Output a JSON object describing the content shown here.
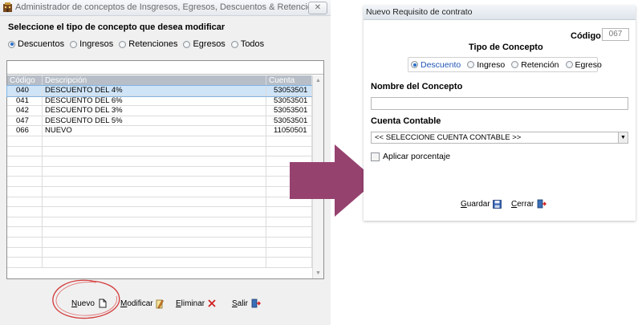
{
  "left_window": {
    "title": "Administrador de conceptos de Insgresos, Egresos, Descuentos & Retenciones",
    "close_label": "✕",
    "heading": "Seleccione el tipo de concepto que desea modificar",
    "filter_options": [
      {
        "label": "Descuentos",
        "checked": true
      },
      {
        "label": "Ingresos",
        "checked": false
      },
      {
        "label": "Retenciones",
        "checked": false
      },
      {
        "label": "Egresos",
        "checked": false
      },
      {
        "label": "Todos",
        "checked": false
      }
    ],
    "table": {
      "columns": [
        "Código",
        "Descripción",
        "Cuenta"
      ],
      "rows": [
        {
          "codigo": "040",
          "descripcion": "DESCUENTO DEL 4%",
          "cuenta": "53053501",
          "selected": true
        },
        {
          "codigo": "041",
          "descripcion": "DESCUENTO DEL 6%",
          "cuenta": "53053501",
          "selected": false
        },
        {
          "codigo": "042",
          "descripcion": "DESCUENTO DEL 3%",
          "cuenta": "53053501",
          "selected": false
        },
        {
          "codigo": "047",
          "descripcion": "DESCUENTO DEL 5%",
          "cuenta": "53053501",
          "selected": false
        },
        {
          "codigo": "066",
          "descripcion": "NUEVO",
          "cuenta": "11050501",
          "selected": false
        }
      ],
      "empty_rows": 13
    },
    "buttons": {
      "nuevo": {
        "first": "N",
        "rest": "uevo"
      },
      "modificar": {
        "first": "M",
        "rest": "odificar"
      },
      "eliminar": {
        "first": "E",
        "rest": "liminar"
      },
      "salir": {
        "first": "S",
        "rest": "alir"
      }
    }
  },
  "right_window": {
    "title": "Nuevo Requisito de contrato",
    "codigo_label": "Código",
    "codigo_value": "067",
    "tipo_heading": "Tipo de Concepto",
    "tipo_options": [
      {
        "label": "Descuento",
        "checked": true
      },
      {
        "label": "Ingreso",
        "checked": false
      },
      {
        "label": "Retención",
        "checked": false
      },
      {
        "label": "Egreso",
        "checked": false
      }
    ],
    "nombre_label": "Nombre del Concepto",
    "nombre_value": "",
    "cuenta_label": "Cuenta Contable",
    "cuenta_selected": "<< SELECCIONE CUENTA CONTABLE >>",
    "aplicar_label": "Aplicar porcentaje",
    "aplicar_checked": false,
    "buttons": {
      "guardar": {
        "first": "G",
        "rest": "uardar"
      },
      "cerrar": {
        "first": "C",
        "rest": "errar"
      }
    }
  },
  "colors": {
    "arrow": "#96426f",
    "annotation_circle": "#d23a3a",
    "selected_row": "#cfe4f7",
    "grid_header": "#b7bec7"
  }
}
